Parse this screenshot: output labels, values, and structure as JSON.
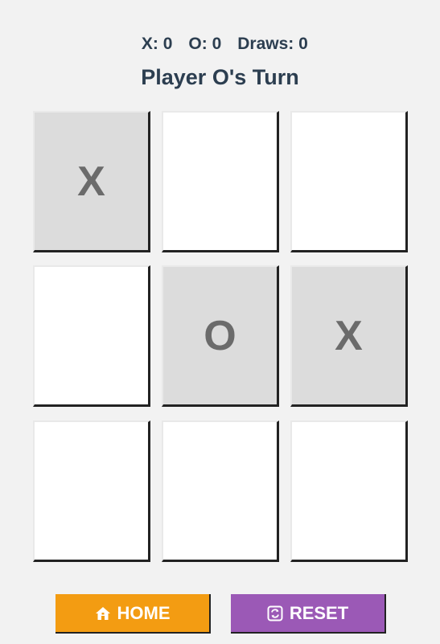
{
  "scoreboard": {
    "x_label": "X:",
    "x_score": "0",
    "o_label": "O:",
    "o_score": "0",
    "draws_label": "Draws:",
    "draws_score": "0"
  },
  "status": {
    "turn_text": "Player O's Turn"
  },
  "board": {
    "cells": [
      "X",
      "",
      "",
      "",
      "O",
      "X",
      "",
      "",
      ""
    ]
  },
  "buttons": {
    "home_label": "HOME",
    "home_icon": "home-icon",
    "reset_label": "RESET",
    "reset_icon": "reset-icon"
  },
  "colors": {
    "home_button": "#f39c12",
    "reset_button": "#9b59b6",
    "filled_cell": "#dcdcdc",
    "empty_cell": "#ffffff",
    "mark_text": "#6b6b6b",
    "heading_text": "#2c3e50"
  }
}
